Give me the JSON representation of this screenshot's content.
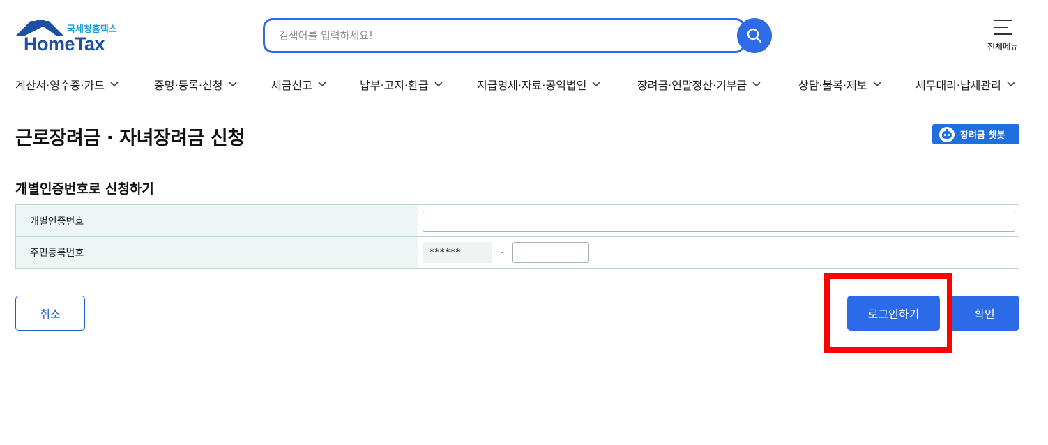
{
  "header": {
    "logo_sub": "국세청홈택스",
    "logo_main": "HomeTax",
    "search_placeholder": "검색어를 입력하세요!",
    "all_menu_label": "전체메뉴"
  },
  "gnb": [
    {
      "label": "계산서·영수증·카드"
    },
    {
      "label": "증명·등록·신청"
    },
    {
      "label": "세금신고"
    },
    {
      "label": "납부·고지·환급"
    },
    {
      "label": "지급명세·자료·공익법인"
    },
    {
      "label": "장려금·연말정산·기부금"
    },
    {
      "label": "상담·불복·제보"
    },
    {
      "label": "세무대리·납세관리"
    }
  ],
  "page": {
    "title": "근로장려금 · 자녀장려금 신청",
    "chatbot_label": "장려금 챗봇",
    "section_title": "개별인증번호로 신청하기"
  },
  "form": {
    "auth_number_label": "개별인증번호",
    "auth_number_value": "",
    "rrn_label": "주민등록번호",
    "rrn_front_masked": "******",
    "rrn_separator": "-",
    "rrn_back_value": ""
  },
  "buttons": {
    "cancel": "취소",
    "login": "로그인하기",
    "confirm": "확인"
  },
  "colors": {
    "primary": "#2b6be7",
    "highlight": "#ff0000",
    "table_header_bg": "#eef6f5"
  }
}
